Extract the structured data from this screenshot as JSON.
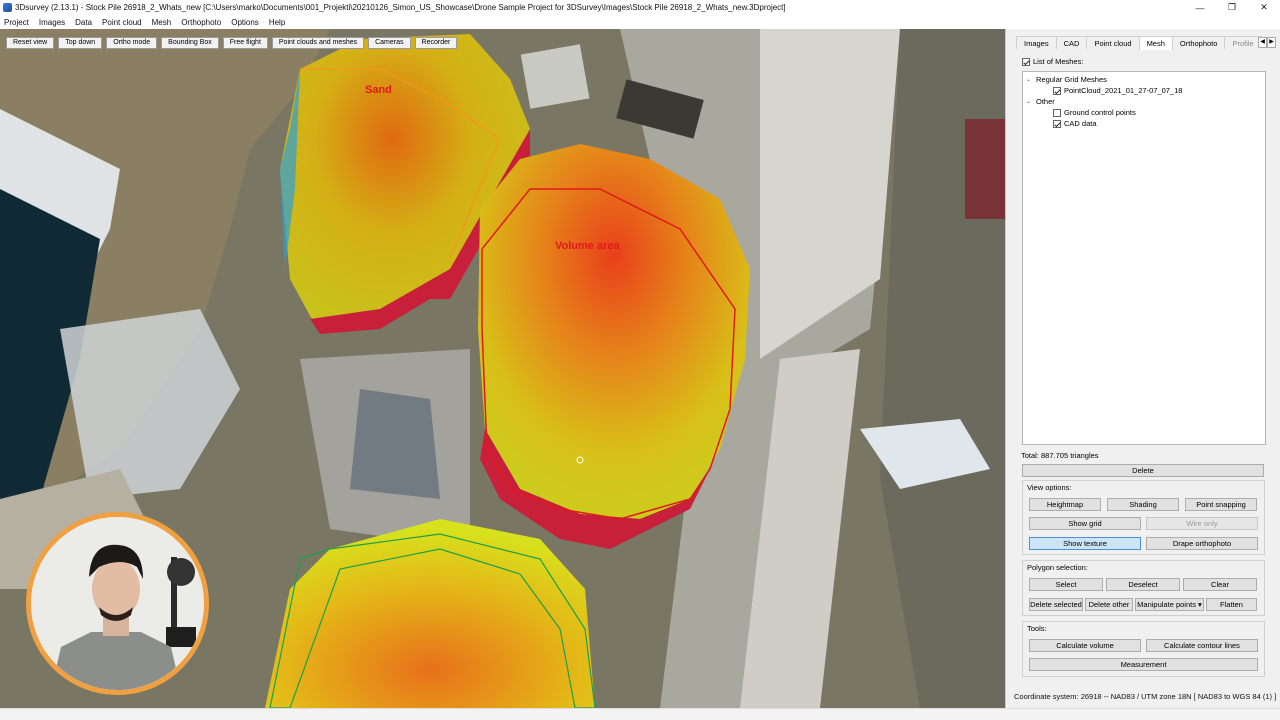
{
  "window": {
    "title": "3Dsurvey (2.13.1) - Stock Pile 26918_2_Whats_new [C:\\Users\\marko\\Documents\\001_Projekti\\20210126_Simon_US_Showcase\\Drone Sample Project for 3DSurvey\\Images\\Stock Pile 26918_2_Whats_new.3Dproject]",
    "minimize": "—",
    "restore": "❐",
    "close": "✕"
  },
  "menu": [
    "Project",
    "Images",
    "Data",
    "Point cloud",
    "Mesh",
    "Orthophoto",
    "Options",
    "Help"
  ],
  "viewport": {
    "toolbar": [
      "Reset view",
      "Top down",
      "Ortho mode",
      "Bounding Box",
      "Free flight",
      "Point clouds and meshes",
      "Cameras",
      "Recorder"
    ],
    "labels": {
      "sand": "Sand",
      "volume_area": "Volume area"
    }
  },
  "panel": {
    "tabs": [
      "Images",
      "CAD",
      "Point cloud",
      "Mesh",
      "Orthophoto",
      "Profile"
    ],
    "active_tab": "Mesh",
    "list_of_meshes": {
      "label": "List of Meshes:",
      "checked": true
    },
    "tree": {
      "group1": "Regular Grid Meshes",
      "item1": "PointCloud_2021_01_27-07_07_18",
      "group2": "Other",
      "item2": "Ground control points",
      "item3": "CAD data"
    },
    "total": "Total: 887.705 triangles",
    "delete": "Delete",
    "view_options": {
      "title": "View options:",
      "heightmap": "Heightmap",
      "shading": "Shading",
      "point_snapping": "Point snapping",
      "show_grid": "Show grid",
      "wire_only": "Wire only",
      "show_texture": "Show texture",
      "drape_orthophoto": "Drape orthophoto"
    },
    "polygon_selection": {
      "title": "Polygon selection:",
      "select": "Select",
      "deselect": "Deselect",
      "clear": "Clear",
      "delete_selected": "Delete selected",
      "delete_other": "Delete other",
      "manipulate_points": "Manipulate points ▾",
      "flatten": "Flatten"
    },
    "tools": {
      "title": "Tools:",
      "calculate_volume": "Calculate volume",
      "calculate_contour_lines": "Calculate contour lines",
      "measurement": "Measurement"
    }
  },
  "status": {
    "coordinate_system": "Coordinate system: 26918 -- NAD83 / UTM zone 18N [ NAD83 to WGS 84 (1) ]"
  },
  "colors": {
    "accent_selected": "#cce4f7",
    "volume_outline": "#e01a1a",
    "webcam_ring": "#f0a040"
  }
}
